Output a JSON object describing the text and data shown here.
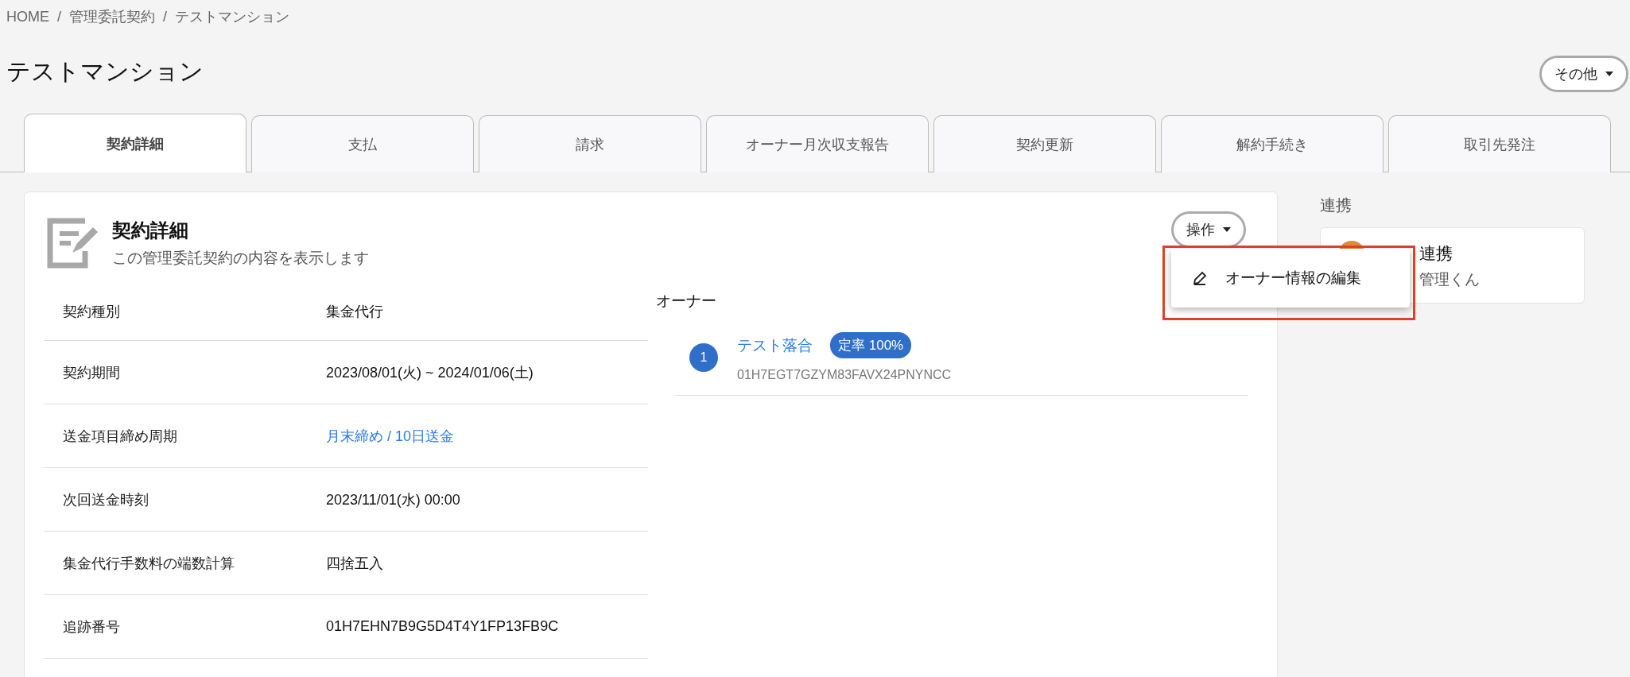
{
  "breadcrumb": [
    "HOME",
    "管理委託契約",
    "テストマンション"
  ],
  "breadcrumb_separator": "/",
  "page_title": "テストマンション",
  "other_button": {
    "label": "その他"
  },
  "tabs": [
    {
      "label": "契約詳細",
      "selected": true
    },
    {
      "label": "支払",
      "selected": false
    },
    {
      "label": "請求",
      "selected": false
    },
    {
      "label": "オーナー月次収支報告",
      "selected": false
    },
    {
      "label": "契約更新",
      "selected": false
    },
    {
      "label": "解約手続き",
      "selected": false
    },
    {
      "label": "取引先発注",
      "selected": false
    }
  ],
  "detail_card": {
    "title": "契約詳細",
    "subtitle": "この管理委託契約の内容を表示します",
    "action_button": {
      "label": "操作"
    },
    "rows": [
      {
        "label": "契約種別",
        "value": "集金代行",
        "kind": "text"
      },
      {
        "label": "契約期間",
        "value": "2023/08/01(火) ~ 2024/01/06(土)",
        "kind": "text"
      },
      {
        "label": "送金項目締め周期",
        "value": "月末締め / 10日送金",
        "kind": "link"
      },
      {
        "label": "次回送金時刻",
        "value": "2023/11/01(水) 00:00",
        "kind": "text"
      },
      {
        "label": "集金代行手数料の端数計算",
        "value": "四捨五入",
        "kind": "text"
      },
      {
        "label": "追跡番号",
        "value": "01H7EHN7B9G5D4T4Y1FP13FB9C",
        "kind": "text"
      }
    ],
    "owners": {
      "heading": "オーナー",
      "items": [
        {
          "number": "1",
          "name": "テスト落合",
          "badge": "定率 100%",
          "id": "01H7EGT7GZYM83FAVX24PNYNCC"
        }
      ]
    }
  },
  "action_menu": {
    "items": [
      {
        "label": "オーナー情報の編集"
      }
    ]
  },
  "integration": {
    "heading": "連携",
    "card_title": "連携",
    "card_subtitle": "管理くん"
  }
}
